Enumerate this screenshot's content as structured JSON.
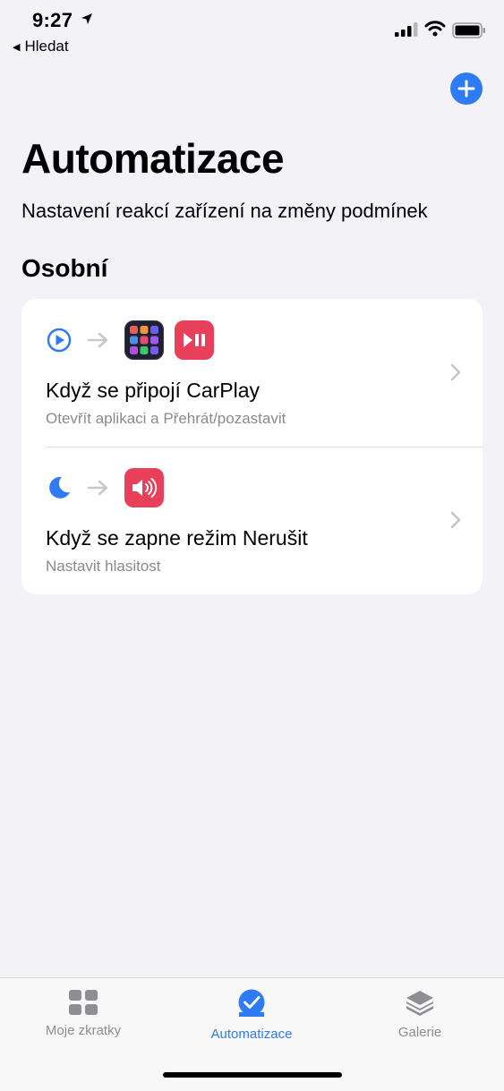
{
  "status_bar": {
    "time": "9:27",
    "back_label": "Hledat"
  },
  "header": {
    "title": "Automatizace",
    "subtitle": "Nastavení reakcí zařízení na změny podmínek"
  },
  "section": {
    "title": "Osobní"
  },
  "automations": [
    {
      "title": "Když se připojí CarPlay",
      "subtitle": "Otevřít aplikaci a Přehrát/pozastavit",
      "trigger_icon": "carplay-icon",
      "action_icons": [
        "app-grid-icon",
        "play-pause-icon"
      ]
    },
    {
      "title": "Když se zapne režim Nerušit",
      "subtitle": "Nastavit hlasitost",
      "trigger_icon": "moon-icon",
      "action_icons": [
        "speaker-icon"
      ]
    }
  ],
  "tab_bar": {
    "tabs": [
      {
        "label": "Moje zkratky",
        "icon": "grid-icon",
        "active": false
      },
      {
        "label": "Automatizace",
        "icon": "checkmark-circle-icon",
        "active": true
      },
      {
        "label": "Galerie",
        "icon": "layers-icon",
        "active": false
      }
    ]
  },
  "colors": {
    "accent": "#2d7cf6",
    "background": "#f2f2f7",
    "action_red": "#e8405a"
  }
}
